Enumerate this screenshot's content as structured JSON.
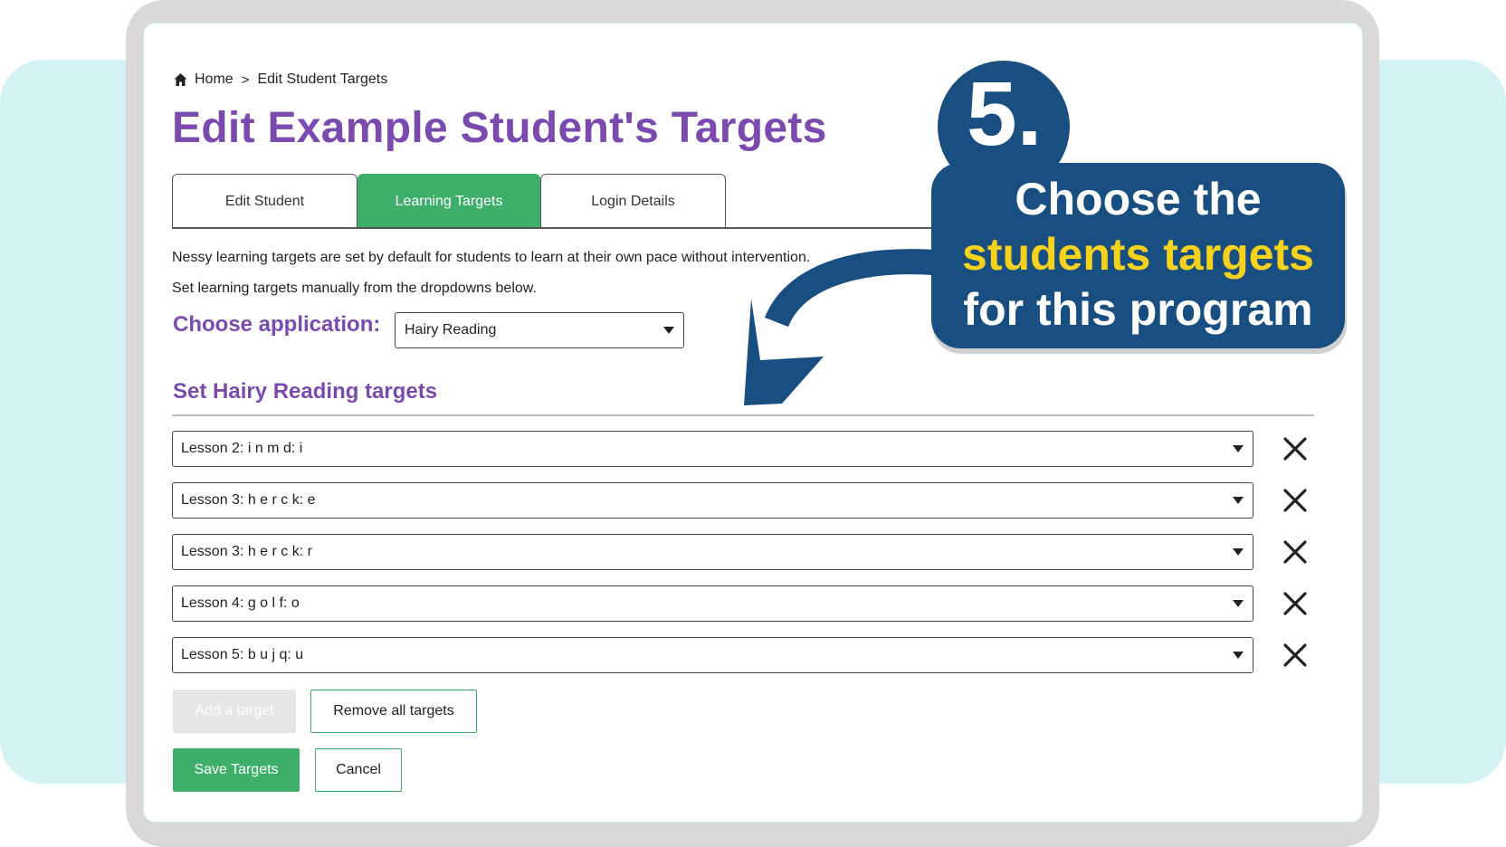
{
  "breadcrumb": {
    "home": "Home",
    "separator": ">",
    "current": "Edit Student Targets"
  },
  "page_title": "Edit Example Student's Targets",
  "tabs": [
    {
      "label": "Edit Student",
      "active": false
    },
    {
      "label": "Learning Targets",
      "active": true
    },
    {
      "label": "Login Details",
      "active": false
    }
  ],
  "description": {
    "line1": "Nessy learning targets are set by default for students to learn at their own pace without intervention.",
    "line2": "Set learning targets manually from the dropdowns below."
  },
  "application": {
    "label": "Choose application:",
    "selected": "Hairy Reading"
  },
  "targets_section": {
    "title": "Set Hairy Reading targets",
    "items": [
      "Lesson 2: i n m d: i",
      "Lesson 3: h e r c k: e",
      "Lesson 3: h e r c k: r",
      "Lesson 4: g o l f: o",
      "Lesson 5: b u j q: u"
    ]
  },
  "buttons": {
    "add_target": "Add a target",
    "remove_all": "Remove all targets",
    "save": "Save Targets",
    "cancel": "Cancel"
  },
  "callout": {
    "number": "5.",
    "line1": "Choose the",
    "line2": "students targets",
    "line3": "for this program"
  },
  "colors": {
    "purple": "#7a4aaf",
    "green": "#3daf6b",
    "navy": "#184f80",
    "highlight": "#f7d21c",
    "teal_bg": "#d4f1f4"
  },
  "icons": {
    "home": "home-icon",
    "dropdown": "caret-down-icon",
    "remove": "close-icon",
    "arrow": "curved-arrow-icon"
  }
}
